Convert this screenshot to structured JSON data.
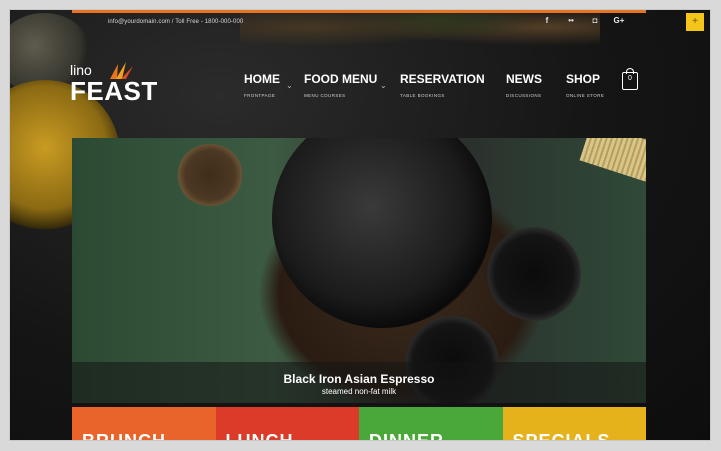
{
  "topbar": {
    "contact": "info@yourdomain.com / Toll Free - 1800-000-000",
    "social": [
      {
        "icon": "facebook-icon",
        "glyph": "f"
      },
      {
        "icon": "flickr-icon",
        "glyph": "••"
      },
      {
        "icon": "instagram-icon",
        "glyph": "◘"
      },
      {
        "icon": "google-plus-icon",
        "glyph": "G+"
      }
    ],
    "corner_button": "+"
  },
  "logo": {
    "small": "lino",
    "big": "FEAST"
  },
  "nav": [
    {
      "label": "HOME",
      "sub": "FRONTPAGE"
    },
    {
      "label": "FOOD MENU",
      "sub": "MENU COURSES"
    },
    {
      "label": "RESERVATION",
      "sub": "TABLE BOOKINGS"
    },
    {
      "label": "NEWS",
      "sub": "DISCUSSIONS"
    },
    {
      "label": "SHOP",
      "sub": "ONLINE STORE"
    }
  ],
  "cart": {
    "count": "0"
  },
  "hero": {
    "title": "Black Iron Asian Espresso",
    "subtitle": "steamed non-fat milk"
  },
  "tiles": [
    {
      "label": "BRUNCH",
      "color": "#e8642a"
    },
    {
      "label": "LUNCH",
      "color": "#dc3b2a"
    },
    {
      "label": "DINNER",
      "color": "#4aa83a"
    },
    {
      "label": "SPECIALS",
      "color": "#e6b21c"
    }
  ]
}
